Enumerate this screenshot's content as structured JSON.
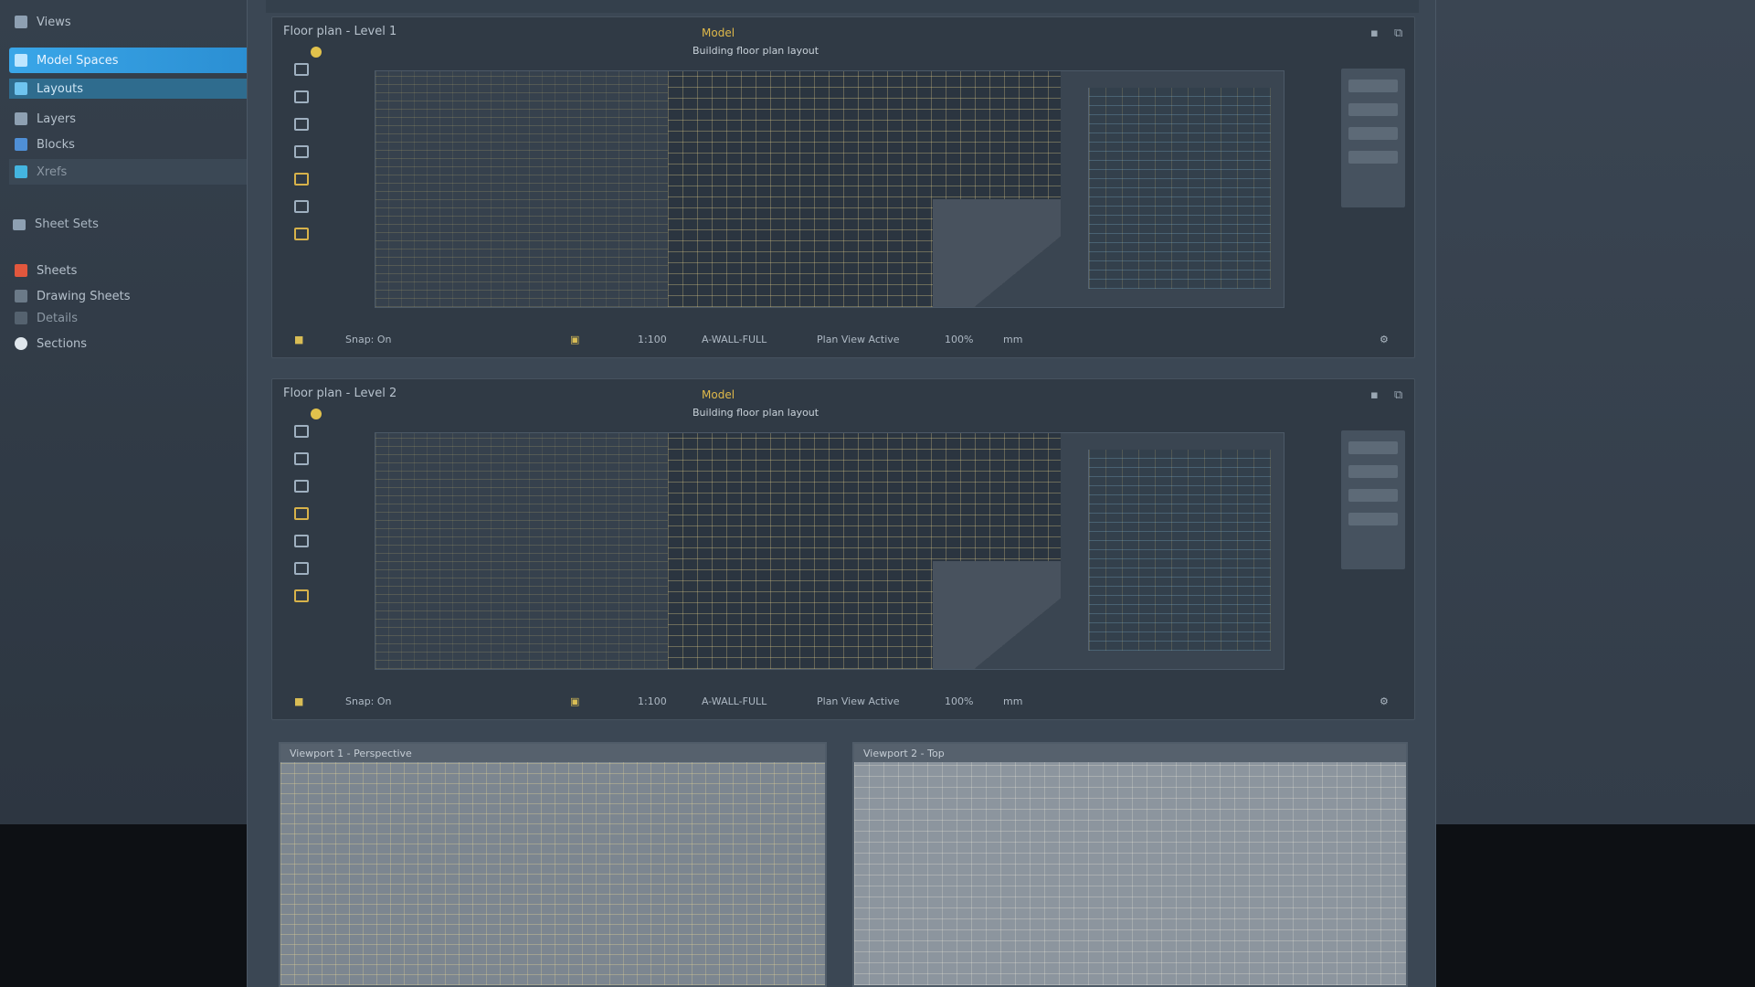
{
  "sidebar": {
    "items": [
      {
        "label": "Views"
      },
      {
        "label": "Model Spaces"
      },
      {
        "label": "Layouts"
      },
      {
        "label": "Layers"
      },
      {
        "label": "Blocks"
      },
      {
        "label": "Xrefs"
      }
    ],
    "section": "Sheet Sets",
    "sheets": [
      {
        "label": "Sheets"
      },
      {
        "label": "Drawing Sheets"
      },
      {
        "label": "Details"
      },
      {
        "label": "Sections"
      }
    ]
  },
  "panels": [
    {
      "title": "Floor plan - Level 1",
      "badge": "Model",
      "subtitle": "Building floor plan layout",
      "status": {
        "coords": "Snap: On",
        "scale": "1:100",
        "layer": "A-WALL-FULL",
        "view": "Plan View Active",
        "zoom": "100%",
        "units": "mm"
      }
    },
    {
      "title": "Floor plan - Level 2",
      "badge": "Model",
      "subtitle": "Building floor plan layout",
      "status": {
        "coords": "Snap: On",
        "scale": "1:100",
        "layer": "A-WALL-FULL",
        "view": "Plan View Active",
        "zoom": "100%",
        "units": "mm"
      }
    }
  ],
  "viewports": [
    {
      "title": "Viewport 1 - Perspective"
    },
    {
      "title": "Viewport 2 - Top"
    }
  ],
  "colors": {
    "accent": "#3aa6e8",
    "highlight": "#e0b94a",
    "background": "#2f3944"
  }
}
